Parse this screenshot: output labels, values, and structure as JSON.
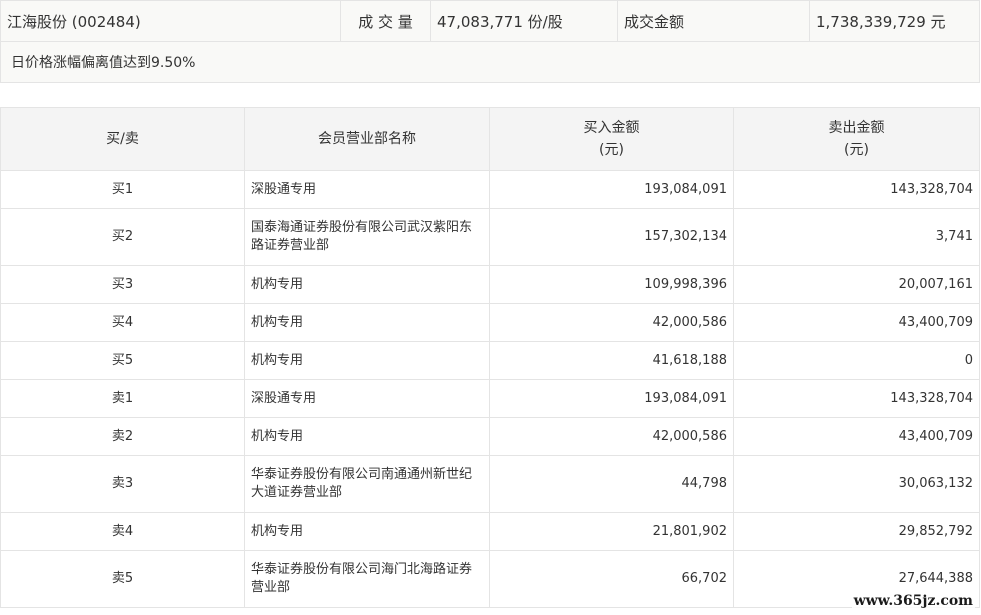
{
  "summary": {
    "stock": "江海股份 (002484)",
    "volume_label": "成 交 量",
    "volume_value": "47,083,771 份/股",
    "amount_label": "成交金额",
    "amount_value": "1,738,339,729 元",
    "note": "日价格涨幅偏离值达到9.50%"
  },
  "table": {
    "headers": {
      "side": "买/卖",
      "seat": "会员营业部名称",
      "buy_l1": "买入金额",
      "buy_l2": "(元)",
      "sell_l1": "卖出金额",
      "sell_l2": "(元)"
    },
    "rows": [
      {
        "side": "买1",
        "seat": "深股通专用",
        "buy": "193,084,091",
        "sell": "143,328,704"
      },
      {
        "side": "买2",
        "seat": "国泰海通证券股份有限公司武汉紫阳东路证券营业部",
        "buy": "157,302,134",
        "sell": "3,741"
      },
      {
        "side": "买3",
        "seat": "机构专用",
        "buy": "109,998,396",
        "sell": "20,007,161"
      },
      {
        "side": "买4",
        "seat": "机构专用",
        "buy": "42,000,586",
        "sell": "43,400,709"
      },
      {
        "side": "买5",
        "seat": "机构专用",
        "buy": "41,618,188",
        "sell": "0"
      },
      {
        "side": "卖1",
        "seat": "深股通专用",
        "buy": "193,084,091",
        "sell": "143,328,704"
      },
      {
        "side": "卖2",
        "seat": "机构专用",
        "buy": "42,000,586",
        "sell": "43,400,709"
      },
      {
        "side": "卖3",
        "seat": "华泰证券股份有限公司南通通州新世纪大道证券营业部",
        "buy": "44,798",
        "sell": "30,063,132"
      },
      {
        "side": "卖4",
        "seat": "机构专用",
        "buy": "21,801,902",
        "sell": "29,852,792"
      },
      {
        "side": "卖5",
        "seat": "华泰证券股份有限公司海门北海路证券营业部",
        "buy": "66,702",
        "sell": "27,644,388"
      }
    ]
  },
  "watermark": "www.365jz.com"
}
